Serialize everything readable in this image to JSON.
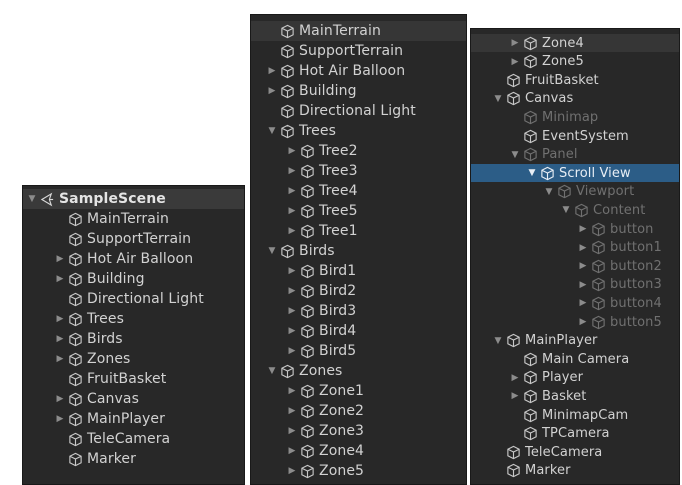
{
  "panels": [
    {
      "id": "panel-a",
      "rows": [
        {
          "label": "SampleScene",
          "depth": 0,
          "arrow": "down",
          "icon": "unity-scene-icon",
          "style": "header"
        },
        {
          "label": "MainTerrain",
          "depth": 1,
          "arrow": "none",
          "icon": "gameobject-cube-icon"
        },
        {
          "label": "SupportTerrain",
          "depth": 1,
          "arrow": "none",
          "icon": "gameobject-cube-icon"
        },
        {
          "label": "Hot Air Balloon",
          "depth": 1,
          "arrow": "right",
          "icon": "gameobject-cube-icon"
        },
        {
          "label": "Building",
          "depth": 1,
          "arrow": "right",
          "icon": "gameobject-cube-icon"
        },
        {
          "label": "Directional Light",
          "depth": 1,
          "arrow": "none",
          "icon": "gameobject-cube-icon"
        },
        {
          "label": "Trees",
          "depth": 1,
          "arrow": "right",
          "icon": "gameobject-cube-icon"
        },
        {
          "label": "Birds",
          "depth": 1,
          "arrow": "right",
          "icon": "gameobject-cube-icon"
        },
        {
          "label": "Zones",
          "depth": 1,
          "arrow": "right",
          "icon": "gameobject-cube-icon"
        },
        {
          "label": "FruitBasket",
          "depth": 1,
          "arrow": "none",
          "icon": "gameobject-cube-icon"
        },
        {
          "label": "Canvas",
          "depth": 1,
          "arrow": "right",
          "icon": "gameobject-cube-icon"
        },
        {
          "label": "MainPlayer",
          "depth": 1,
          "arrow": "right",
          "icon": "gameobject-cube-icon"
        },
        {
          "label": "TeleCamera",
          "depth": 1,
          "arrow": "none",
          "icon": "gameobject-cube-icon"
        },
        {
          "label": "Marker",
          "depth": 1,
          "arrow": "none",
          "icon": "gameobject-cube-icon"
        }
      ]
    },
    {
      "id": "panel-b",
      "rows": [
        {
          "label": "MainTerrain",
          "depth": 0,
          "arrow": "none",
          "icon": "gameobject-cube-icon",
          "style": "hl"
        },
        {
          "label": "SupportTerrain",
          "depth": 0,
          "arrow": "none",
          "icon": "gameobject-cube-icon"
        },
        {
          "label": "Hot Air Balloon",
          "depth": 0,
          "arrow": "right",
          "icon": "gameobject-cube-icon"
        },
        {
          "label": "Building",
          "depth": 0,
          "arrow": "right",
          "icon": "gameobject-cube-icon"
        },
        {
          "label": "Directional Light",
          "depth": 0,
          "arrow": "none",
          "icon": "gameobject-cube-icon"
        },
        {
          "label": "Trees",
          "depth": 0,
          "arrow": "down",
          "icon": "gameobject-cube-icon"
        },
        {
          "label": "Tree2",
          "depth": 1,
          "arrow": "right",
          "icon": "gameobject-cube-icon"
        },
        {
          "label": "Tree3",
          "depth": 1,
          "arrow": "right",
          "icon": "gameobject-cube-icon"
        },
        {
          "label": "Tree4",
          "depth": 1,
          "arrow": "right",
          "icon": "gameobject-cube-icon"
        },
        {
          "label": "Tree5",
          "depth": 1,
          "arrow": "right",
          "icon": "gameobject-cube-icon"
        },
        {
          "label": "Tree1",
          "depth": 1,
          "arrow": "right",
          "icon": "gameobject-cube-icon"
        },
        {
          "label": "Birds",
          "depth": 0,
          "arrow": "down",
          "icon": "gameobject-cube-icon"
        },
        {
          "label": "Bird1",
          "depth": 1,
          "arrow": "right",
          "icon": "gameobject-cube-icon"
        },
        {
          "label": "Bird2",
          "depth": 1,
          "arrow": "right",
          "icon": "gameobject-cube-icon"
        },
        {
          "label": "Bird3",
          "depth": 1,
          "arrow": "right",
          "icon": "gameobject-cube-icon"
        },
        {
          "label": "Bird4",
          "depth": 1,
          "arrow": "right",
          "icon": "gameobject-cube-icon"
        },
        {
          "label": "Bird5",
          "depth": 1,
          "arrow": "right",
          "icon": "gameobject-cube-icon"
        },
        {
          "label": "Zones",
          "depth": 0,
          "arrow": "down",
          "icon": "gameobject-cube-icon"
        },
        {
          "label": "Zone1",
          "depth": 1,
          "arrow": "right",
          "icon": "gameobject-cube-icon"
        },
        {
          "label": "Zone2",
          "depth": 1,
          "arrow": "right",
          "icon": "gameobject-cube-icon"
        },
        {
          "label": "Zone3",
          "depth": 1,
          "arrow": "right",
          "icon": "gameobject-cube-icon"
        },
        {
          "label": "Zone4",
          "depth": 1,
          "arrow": "right",
          "icon": "gameobject-cube-icon"
        },
        {
          "label": "Zone5",
          "depth": 1,
          "arrow": "right",
          "icon": "gameobject-cube-icon"
        }
      ]
    },
    {
      "id": "panel-c",
      "rows": [
        {
          "label": "Zone4",
          "depth": 1,
          "arrow": "right",
          "icon": "gameobject-cube-icon",
          "style": "hl"
        },
        {
          "label": "Zone5",
          "depth": 1,
          "arrow": "right",
          "icon": "gameobject-cube-icon"
        },
        {
          "label": "FruitBasket",
          "depth": 0,
          "arrow": "none",
          "icon": "gameobject-cube-icon"
        },
        {
          "label": "Canvas",
          "depth": 0,
          "arrow": "down",
          "icon": "gameobject-cube-icon"
        },
        {
          "label": "Minimap",
          "depth": 1,
          "arrow": "none",
          "icon": "gameobject-cube-icon",
          "style": "dim"
        },
        {
          "label": "EventSystem",
          "depth": 1,
          "arrow": "none",
          "icon": "gameobject-cube-icon"
        },
        {
          "label": "Panel",
          "depth": 1,
          "arrow": "down",
          "icon": "gameobject-cube-icon",
          "style": "dim"
        },
        {
          "label": "Scroll View",
          "depth": 2,
          "arrow": "down",
          "icon": "gameobject-cube-icon",
          "style": "selected"
        },
        {
          "label": "Viewport",
          "depth": 3,
          "arrow": "down",
          "icon": "gameobject-cube-icon",
          "style": "dim"
        },
        {
          "label": "Content",
          "depth": 4,
          "arrow": "down",
          "icon": "gameobject-cube-icon",
          "style": "dim"
        },
        {
          "label": "button",
          "depth": 5,
          "arrow": "right",
          "icon": "gameobject-cube-icon",
          "style": "dim"
        },
        {
          "label": "button1",
          "depth": 5,
          "arrow": "right",
          "icon": "gameobject-cube-icon",
          "style": "dim"
        },
        {
          "label": "button2",
          "depth": 5,
          "arrow": "right",
          "icon": "gameobject-cube-icon",
          "style": "dim"
        },
        {
          "label": "button3",
          "depth": 5,
          "arrow": "right",
          "icon": "gameobject-cube-icon",
          "style": "dim"
        },
        {
          "label": "button4",
          "depth": 5,
          "arrow": "right",
          "icon": "gameobject-cube-icon",
          "style": "dim"
        },
        {
          "label": "button5",
          "depth": 5,
          "arrow": "right",
          "icon": "gameobject-cube-icon",
          "style": "dim"
        },
        {
          "label": "MainPlayer",
          "depth": 0,
          "arrow": "down",
          "icon": "gameobject-cube-icon"
        },
        {
          "label": "Main Camera",
          "depth": 1,
          "arrow": "none",
          "icon": "gameobject-cube-icon"
        },
        {
          "label": "Player",
          "depth": 1,
          "arrow": "right",
          "icon": "gameobject-cube-icon"
        },
        {
          "label": "Basket",
          "depth": 1,
          "arrow": "right",
          "icon": "gameobject-cube-icon"
        },
        {
          "label": "MinimapCam",
          "depth": 1,
          "arrow": "none",
          "icon": "gameobject-cube-icon"
        },
        {
          "label": "TPCamera",
          "depth": 1,
          "arrow": "none",
          "icon": "gameobject-cube-icon"
        },
        {
          "label": "TeleCamera",
          "depth": 0,
          "arrow": "none",
          "icon": "gameobject-cube-icon"
        },
        {
          "label": "Marker",
          "depth": 0,
          "arrow": "none",
          "icon": "gameobject-cube-icon"
        }
      ]
    }
  ],
  "colors": {
    "panel_bg": "#282828",
    "selected_bg": "#2c5d87",
    "text": "#d2d2d2",
    "dim_text": "#707070"
  }
}
